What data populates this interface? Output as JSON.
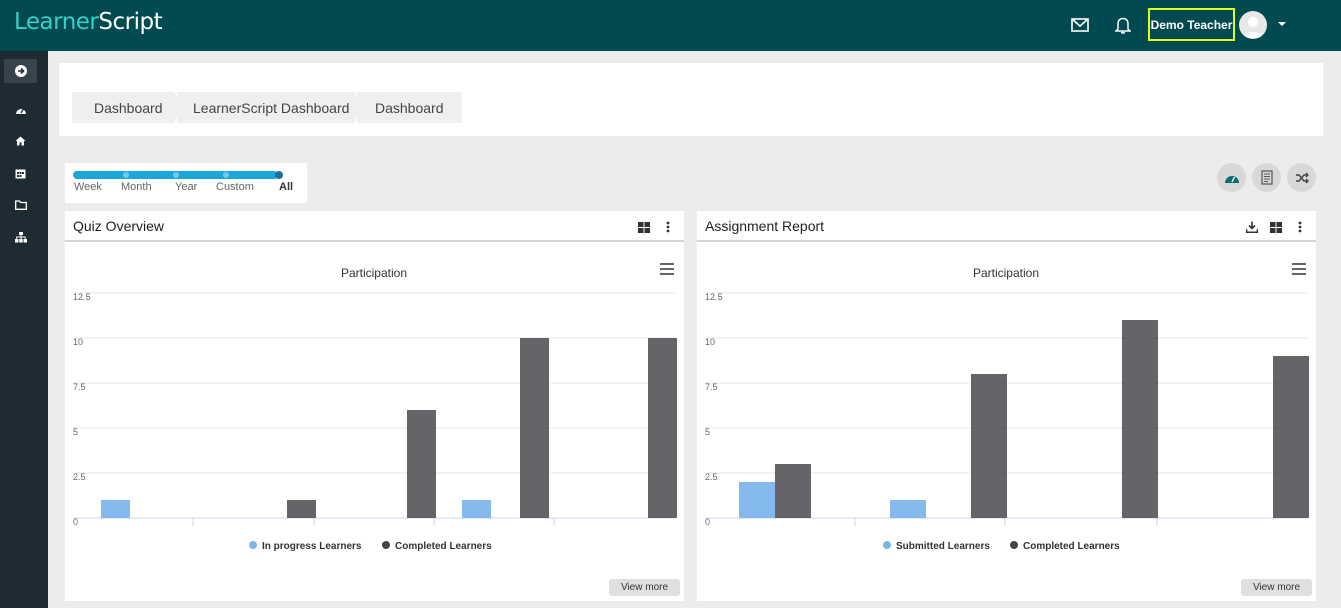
{
  "app": {
    "logo_part1": "Learner",
    "logo_part2": "Script"
  },
  "header": {
    "user_name": "Demo Teacher"
  },
  "breadcrumb": {
    "items": [
      "Dashboard",
      "LearnerScript Dashboard",
      "Dashboard"
    ]
  },
  "filter": {
    "options": [
      "Week",
      "Month",
      "Year",
      "Custom",
      "All"
    ],
    "selected": "All"
  },
  "widgets": [
    {
      "title": "Quiz Overview",
      "view_more": "View more"
    },
    {
      "title": "Assignment Report",
      "view_more": "View more"
    }
  ],
  "icons": {
    "header": [
      "mail-icon",
      "bell-icon",
      "avatar",
      "chevron-down-icon"
    ],
    "sidebar": [
      "arrow-right-circle-icon",
      "dashboard-icon",
      "home-icon",
      "calendar-icon",
      "folder-icon",
      "sitemap-icon"
    ],
    "toolbar": [
      "gauge-icon",
      "report-icon",
      "shuffle-icon"
    ]
  },
  "chart_data": [
    {
      "type": "bar",
      "title": "Participation",
      "ylim": [
        0,
        12.5
      ],
      "yticks": [
        "0",
        "2.5",
        "5",
        "7.5",
        "10",
        "12.5"
      ],
      "categories": [
        "",
        "",
        "",
        "",
        ""
      ],
      "series": [
        {
          "name": "In progress Learners",
          "color": "#7cb5ec",
          "values": [
            1,
            0,
            0,
            1,
            0
          ]
        },
        {
          "name": "Completed Learners",
          "color": "#434348",
          "values": [
            0,
            1,
            6,
            10,
            10
          ]
        }
      ],
      "grid": true,
      "legend": "bottom"
    },
    {
      "type": "bar",
      "title": "Participation",
      "ylim": [
        0,
        12.5
      ],
      "yticks": [
        "0",
        "2.5",
        "5",
        "7.5",
        "10",
        "12.5"
      ],
      "categories": [
        "",
        "",
        "",
        ""
      ],
      "series": [
        {
          "name": "Submitted Learners",
          "color": "#7cb5ec",
          "values": [
            2,
            1,
            0,
            0
          ]
        },
        {
          "name": "Completed Learners",
          "color": "#434348",
          "values": [
            3,
            8,
            11,
            9
          ]
        }
      ],
      "grid": true,
      "legend": "bottom"
    }
  ]
}
